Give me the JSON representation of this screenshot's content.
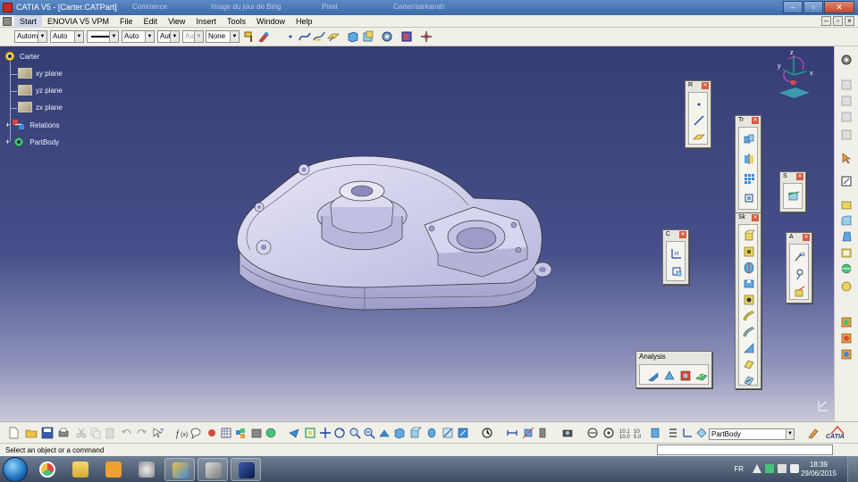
{
  "window": {
    "title": "CATIA V5 - [Carter.CATPart]",
    "ghost_tabs": [
      "Commerce",
      "Image du jour de Bing",
      "Pixel",
      "Carter/sarkanah"
    ]
  },
  "menu": {
    "items": [
      "Start",
      "ENOVIA V5 VPM",
      "File",
      "Edit",
      "View",
      "Insert",
      "Tools",
      "Window",
      "Help"
    ]
  },
  "graphic_props": {
    "fill_color": "Autom",
    "transparency": "Auto",
    "line_thickness": "",
    "line_type": "Auto",
    "point_symbol": "Aut",
    "rendering": "Aut",
    "layer": "None"
  },
  "spec_tree": {
    "root": "Carter",
    "items": [
      "xy plane",
      "yz plane",
      "zx plane",
      "Relations",
      "PartBody"
    ]
  },
  "toolbars": {
    "reference_elements": "R",
    "transformations": "Tr",
    "surface_based": "S",
    "sketch_based": "Sk",
    "constraints": "C",
    "annotations": "A",
    "analysis": "Analysis"
  },
  "compass": {
    "axis_x": "x",
    "axis_y": "y",
    "axis_z": "z"
  },
  "bottom": {
    "current_body": "PartBody",
    "catia_logo": "CATIA"
  },
  "status": {
    "message": "Select an object or a command"
  },
  "taskbar": {
    "language": "FR",
    "time": "18:39",
    "date": "29/06/2015"
  },
  "colors": {
    "viewport_top": "#363d74",
    "viewport_bottom": "#c9c8da",
    "part": "#c8c6ea",
    "toolbar_bg": "#f0efe8",
    "title_blue": "#3e6aa8"
  }
}
